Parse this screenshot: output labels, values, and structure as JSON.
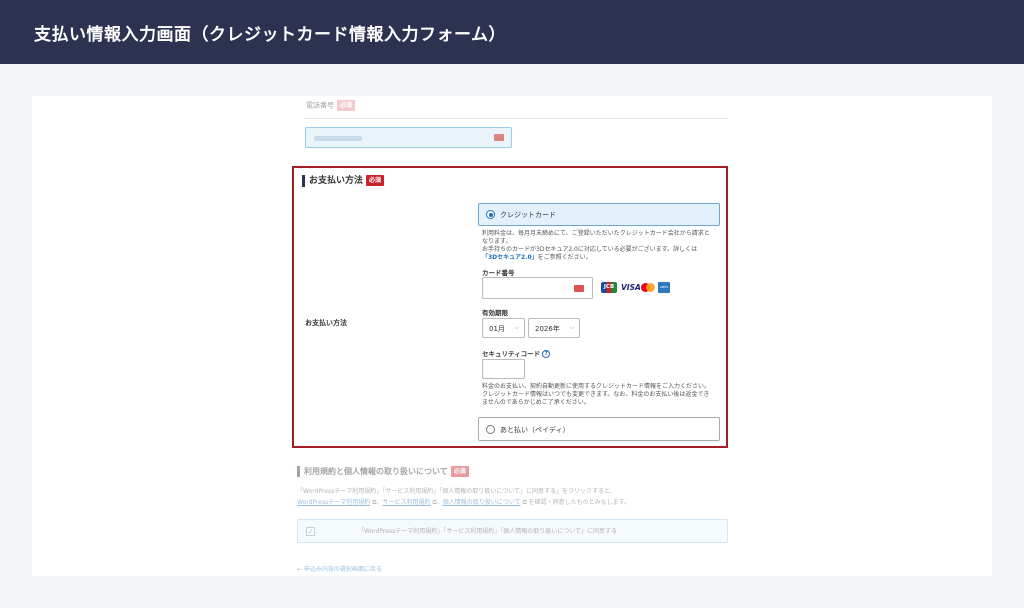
{
  "header": {
    "title": "支払い情報入力画面（クレジットカード情報入力フォーム）"
  },
  "phone": {
    "label": "電話番号",
    "required": "必須"
  },
  "payment": {
    "section_title": "お支払い方法",
    "required": "必須",
    "row_label": "お支払い方法",
    "credit": {
      "option_label": "クレジットカード",
      "desc_line1": "利用料金は、毎月月末締めにて、ご登録いただいたクレジットカード会社から請求と",
      "desc_line2": "なります。",
      "desc_line3": "お手持ちのカードが3Dセキュア2.0に対応している必要がございます。詳しくは",
      "desc_link": "「3Dセキュア2.0」",
      "desc_suffix": "をご参照ください。",
      "card_number_label": "カード番号",
      "card_brands": [
        "JCB",
        "VISA",
        "Mastercard",
        "AMEX"
      ],
      "expiry_label": "有効期限",
      "expiry_month": "01月",
      "expiry_year": "2026年",
      "cvc_label": "セキュリティコード",
      "cvc_help": "?",
      "note_line1": "料金のお支払い、契約自動更新に使用するクレジットカード情報をご入力ください。",
      "note_line2": "クレジットカード情報はいつでも変更できます。なお、料金のお支払い後は返金でき",
      "note_line3": "ませんのであらかじめご了承ください。"
    },
    "paidy": {
      "option_label": "あと払い（ペイディ）"
    }
  },
  "terms": {
    "section_title": "利用規約と個人情報の取り扱いについて",
    "required": "必須",
    "text_line1": "「WordPressテーマ利用規約」「サービス利用規約」「個人情報の取り扱いについて」に同意する」をクリックすると、",
    "link1": "WordPressテーマ利用規約",
    "link2": "サービス利用規約",
    "link3": "個人情報の取り扱いについて",
    "text_tail": "を確認・同意したものとみなします。",
    "agree_label": "「WordPressテーマ利用規約」「サービス利用規約」「個人情報の取り扱いについて」に同意する",
    "back_link": "← 申込み内容の選択画面に戻る"
  }
}
